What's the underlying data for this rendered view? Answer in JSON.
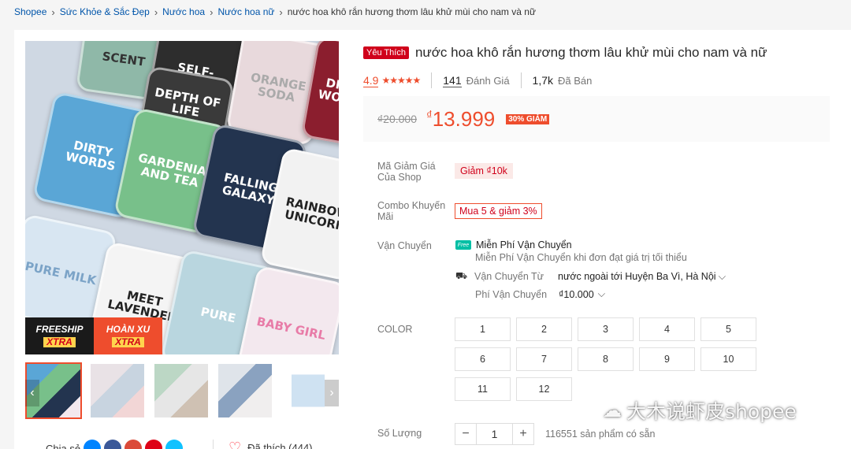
{
  "breadcrumb": {
    "items": [
      "Shopee",
      "Sức Khỏe & Sắc Đẹp",
      "Nước hoa",
      "Nước hoa nữ"
    ],
    "current": "nước hoa khô rắn hương thơm lâu khử mùi cho nam và nữ"
  },
  "product": {
    "badge": "Yêu Thích",
    "title": "nước hoa khô rắn hương thơm lâu khử mùi cho nam và nữ",
    "rating": "4.9",
    "stars": "★★★★★",
    "reviews_count": "141",
    "reviews_label": "Đánh Giá",
    "sold_count": "1,7k",
    "sold_label": "Đã Bán",
    "old_price": "₫20.000",
    "currency": "₫",
    "price": "13.999",
    "discount": "30% GIẢM"
  },
  "gallery": {
    "tins": [
      "SCENT",
      "SELF-SALVATION",
      "DEPTH OF LIFE",
      "ORANGE SODA",
      "DIRTY WORDS",
      "DIRTY WORDS",
      "GARDENIA AND TEA",
      "FALLING GALAXY",
      "RAINBOW UNICORN",
      "PURE MILK",
      "MEET LAVENDER",
      "PURE",
      "BABY GIRL"
    ],
    "badge_freeship": "FREESHIP",
    "badge_hoanxu": "HOÀN XU",
    "badge_xtra": "XTRA",
    "prev_icon": "chevron-left",
    "next_icon": "chevron-right"
  },
  "share": {
    "label": "Chia sẻ",
    "liked": "Đã thích (444)"
  },
  "voucher": {
    "label": "Mã Giảm Giá Của Shop",
    "value": "Giảm ₫10k"
  },
  "combo": {
    "label": "Combo Khuyến Mãi",
    "value": "Mua 5 & giảm 3%"
  },
  "shipping": {
    "label": "Vận Chuyển",
    "free_icon": "Free",
    "free_title": "Miễn Phí Vận Chuyển",
    "free_desc": "Miễn Phí Vận Chuyển khi đơn đạt giá trị tối thiểu",
    "from_label": "Vận Chuyển Từ",
    "from_value": "nước ngoài tới Huyện Ba Vì, Hà Nội",
    "fee_label": "Phí Vận Chuyển",
    "fee_value": "₫10.000"
  },
  "color": {
    "label": "COLOR",
    "options": [
      "1",
      "2",
      "3",
      "4",
      "5",
      "6",
      "7",
      "8",
      "9",
      "10",
      "11",
      "12"
    ]
  },
  "quantity": {
    "label": "Số Lượng",
    "minus": "−",
    "value": "1",
    "plus": "+",
    "stock": "116551 sản phẩm có sẵn"
  },
  "watermark": {
    "text": "大木说虾皮shopee"
  },
  "colors": {
    "accent": "#ee4d2d",
    "link": "#0055aa"
  }
}
